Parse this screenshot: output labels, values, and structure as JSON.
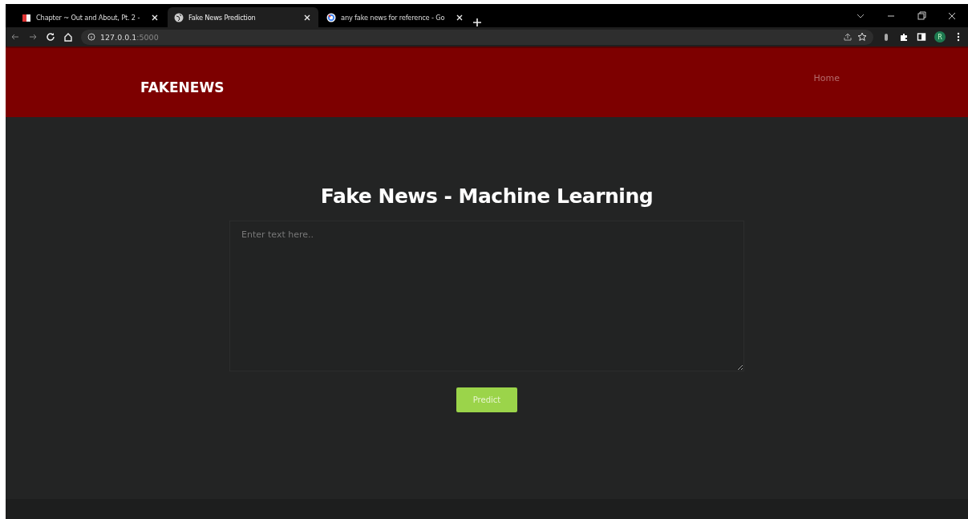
{
  "browser": {
    "tabs": [
      {
        "title": "Chapter ~ Out and About, Pt. 2 -",
        "selected": false
      },
      {
        "title": "Fake News Prediction",
        "selected": true
      },
      {
        "title": "any fake news for reference - Go",
        "selected": false
      }
    ],
    "address": {
      "host": "127.0.0.1",
      "port": ":5000"
    },
    "profile": "R"
  },
  "header": {
    "brand": "FAKENEWS",
    "nav": [
      "Home"
    ]
  },
  "main": {
    "title": "Fake News - Machine Learning",
    "textarea": {
      "placeholder": "Enter text here.."
    },
    "button": "Predict"
  }
}
